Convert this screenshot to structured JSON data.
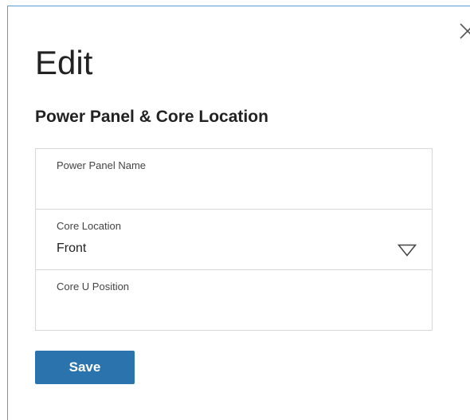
{
  "dialog": {
    "title": "Edit",
    "subtitle": "Power Panel & Core Location",
    "close_icon": "close-icon"
  },
  "form": {
    "power_panel_name": {
      "label": "Power Panel Name",
      "value": ""
    },
    "core_location": {
      "label": "Core Location",
      "selected": "Front",
      "icon": "chevron-down-icon"
    },
    "core_u_position": {
      "label": "Core U Position",
      "value": ""
    }
  },
  "actions": {
    "save_label": "Save"
  },
  "colors": {
    "accent": "#2a73ad",
    "dialog_border": "#5b9bd5",
    "field_border": "#d7d7d7"
  }
}
